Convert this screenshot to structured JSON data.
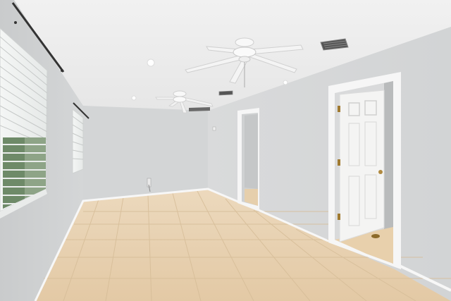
{
  "scene": {
    "subject": "empty-room-interior",
    "elements": [
      "ceiling-fan",
      "ceiling-fan",
      "window-blinds",
      "window-blinds",
      "open-doorway",
      "interior-door",
      "tile-floor",
      "recessed-lights",
      "ceiling-vent",
      "ceiling-vent",
      "curtain-rod",
      "curtain-rod"
    ]
  },
  "colors": {
    "wall": "#d6d8d9",
    "wall_light": "#e1e2e3",
    "ceiling": "#efefef",
    "floor": "#e8d2b3",
    "floor_grout": "#d2b994",
    "trim": "#f7f7f7",
    "door": "#f4f4f3",
    "hinge": "#a07a30"
  }
}
